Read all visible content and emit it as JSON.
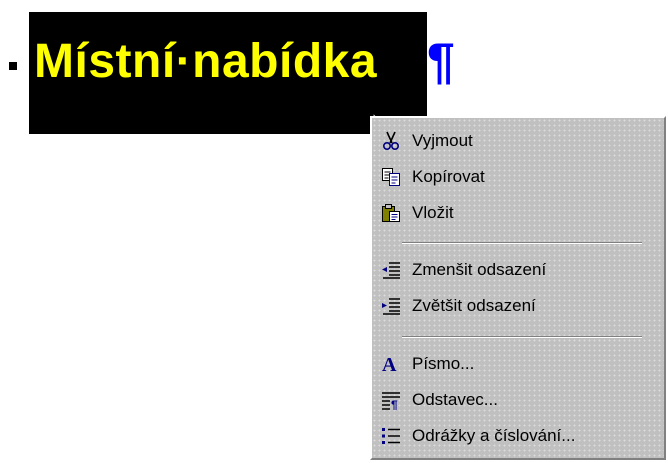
{
  "document": {
    "heading": "Místní·nabídka",
    "pilcrow": "¶",
    "colors": {
      "selection_bg": "#000000",
      "heading_text": "#ffff00",
      "pilcrow": "#0000ff"
    }
  },
  "context_menu": {
    "items": [
      {
        "label": "Vyjmout",
        "icon": "scissors-icon"
      },
      {
        "label": "Kopírovat",
        "icon": "copy-icon"
      },
      {
        "label": "Vložit",
        "icon": "paste-icon"
      },
      {
        "label": "Zmenšit odsazení",
        "icon": "decrease-indent-icon"
      },
      {
        "label": "Zvětšit odsazení",
        "icon": "increase-indent-icon"
      },
      {
        "label": "Písmo...",
        "icon": "font-icon"
      },
      {
        "label": "Odstavec...",
        "icon": "paragraph-icon"
      },
      {
        "label": "Odrážky a číslování...",
        "icon": "bullets-numbering-icon"
      }
    ]
  }
}
